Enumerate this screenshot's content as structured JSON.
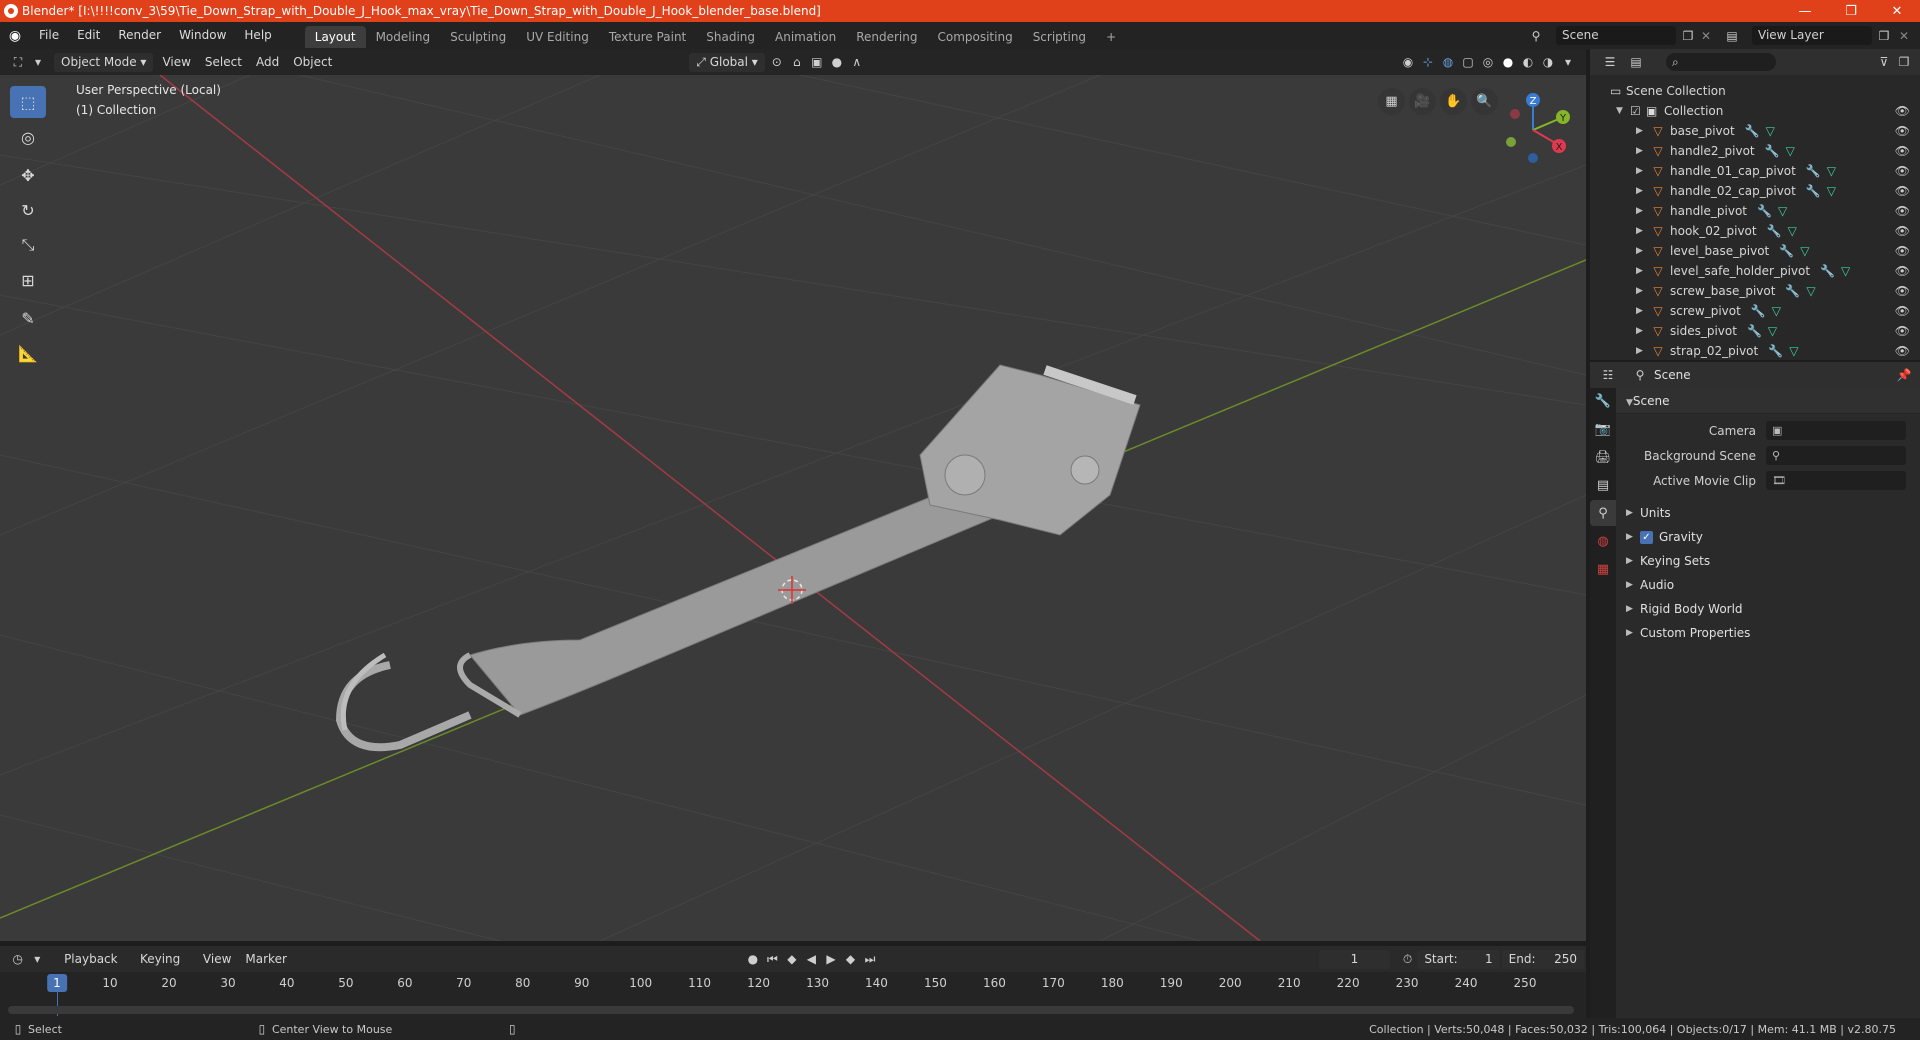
{
  "window": {
    "title": "Blender* [I:\\!!!!conv_3\\59\\Tie_Down_Strap_with_Double_J_Hook_max_vray\\Tie_Down_Strap_with_Double_J_Hook_blender_base.blend]",
    "minimize": "—",
    "maximize": "❐",
    "close": "✕"
  },
  "topbar": {
    "menus": [
      "File",
      "Edit",
      "Render",
      "Window",
      "Help"
    ],
    "workspaces": [
      "Layout",
      "Modeling",
      "Sculpting",
      "UV Editing",
      "Texture Paint",
      "Shading",
      "Animation",
      "Rendering",
      "Compositing",
      "Scripting"
    ],
    "active_workspace": "Layout",
    "add_workspace": "+",
    "scene": "Scene",
    "view_layer": "View Layer"
  },
  "viewport_header": {
    "mode": "Object Mode",
    "menus": [
      "View",
      "Select",
      "Add",
      "Object"
    ],
    "transform_orientation": "Global"
  },
  "viewport": {
    "perspective": "User Perspective (Local)",
    "collection": "(1) Collection",
    "gizmo_axes": [
      "Z",
      "Y",
      "X"
    ]
  },
  "toolbar": {
    "tools": [
      "select-box-icon",
      "cursor-icon",
      "move-icon",
      "rotate-icon",
      "scale-icon",
      "transform-icon",
      "annotate-icon",
      "measure-icon"
    ]
  },
  "outliner": {
    "root": "Scene Collection",
    "collection": "Collection",
    "objects": [
      "base_pivot",
      "handle2_pivot",
      "handle_01_cap_pivot",
      "handle_02_cap_pivot",
      "handle_pivot",
      "hook_02_pivot",
      "level_base_pivot",
      "level_safe_holder_pivot",
      "screw_base_pivot",
      "screw_pivot",
      "sides_pivot",
      "strap_02_pivot"
    ]
  },
  "properties": {
    "header": "Scene",
    "panel": "Scene",
    "camera_label": "Camera",
    "background_scene_label": "Background Scene",
    "active_movie_clip_label": "Active Movie Clip",
    "subpanels": [
      "Units",
      "Gravity",
      "Keying Sets",
      "Audio",
      "Rigid Body World",
      "Custom Properties"
    ],
    "gravity_checked": true
  },
  "timeline": {
    "menus": [
      "Playback",
      "Keying",
      "View",
      "Marker"
    ],
    "current_frame": "1",
    "start_label": "Start:",
    "start": "1",
    "end_label": "End:",
    "end": "250",
    "ruler": [
      "1",
      "10",
      "20",
      "30",
      "40",
      "50",
      "60",
      "70",
      "80",
      "90",
      "100",
      "110",
      "120",
      "130",
      "140",
      "150",
      "160",
      "170",
      "180",
      "190",
      "200",
      "210",
      "220",
      "230",
      "240",
      "250"
    ]
  },
  "statusbar": {
    "select": "Select",
    "center_view": "Center View to Mouse",
    "stats": "Collection | Verts:50,048 | Faces:50,032 | Tris:100,064 | Objects:0/17 | Mem: 41.1 MB | v2.80.75"
  },
  "colors": {
    "titlebar": "#e0401a",
    "accent": "#4772b3",
    "x_axis": "#e0394f",
    "y_axis": "#86b627",
    "z_axis": "#3a7bd5",
    "object_icon": "#e8843a"
  }
}
